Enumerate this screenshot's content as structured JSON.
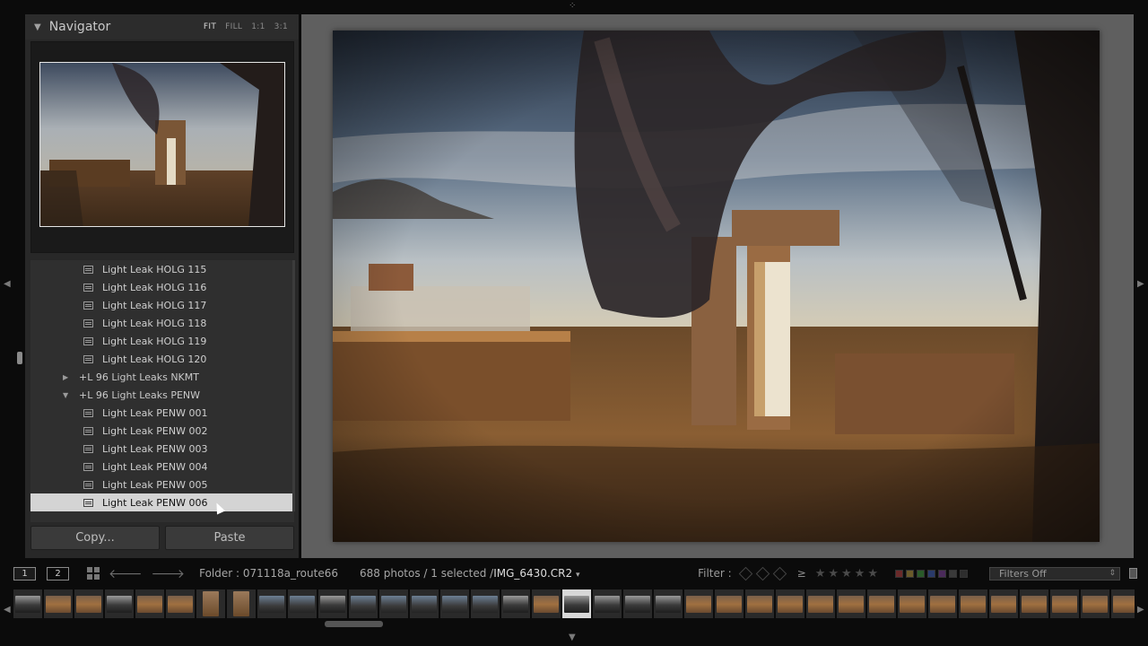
{
  "navigator": {
    "title": "Navigator",
    "zoom_options": [
      "FIT",
      "FILL",
      "1:1",
      "3:1"
    ],
    "active_zoom": "FIT"
  },
  "presets": [
    {
      "type": "preset",
      "label": "Light Leak HOLG 115"
    },
    {
      "type": "preset",
      "label": "Light Leak HOLG 116"
    },
    {
      "type": "preset",
      "label": "Light Leak HOLG 117"
    },
    {
      "type": "preset",
      "label": "Light Leak HOLG 118"
    },
    {
      "type": "preset",
      "label": "Light Leak HOLG 119"
    },
    {
      "type": "preset",
      "label": "Light Leak HOLG 120"
    },
    {
      "type": "folder",
      "label": "+L 96 Light Leaks NKMT",
      "expanded": false
    },
    {
      "type": "folder",
      "label": "+L 96 Light Leaks PENW",
      "expanded": true
    },
    {
      "type": "preset",
      "label": "Light Leak PENW 001"
    },
    {
      "type": "preset",
      "label": "Light Leak PENW 002"
    },
    {
      "type": "preset",
      "label": "Light Leak PENW 003"
    },
    {
      "type": "preset",
      "label": "Light Leak PENW 004"
    },
    {
      "type": "preset",
      "label": "Light Leak PENW 005"
    },
    {
      "type": "preset",
      "label": "Light Leak PENW 006",
      "selected": true
    }
  ],
  "buttons": {
    "copy": "Copy...",
    "paste": "Paste"
  },
  "toolbar": {
    "screen1": "1",
    "screen2": "2",
    "folder": "Folder : 071118a_route66",
    "count": "688 photos / 1 selected /",
    "filename": "IMG_6430.CR2",
    "filter_label": "Filter :",
    "rating_op": "≥",
    "filters_off": "Filters Off"
  },
  "colors": {
    "swatches": [
      "#6a2a2a",
      "#6a5a2a",
      "#2a5a2a",
      "#2a3a6a",
      "#4a2a5a",
      "#3a3a3a",
      "#2e2e2e"
    ]
  },
  "filmstrip": {
    "thumbs": [
      "dark",
      "warm",
      "warm",
      "dark",
      "warm",
      "warm",
      "portrait",
      "portrait",
      "blue",
      "blue",
      "dark",
      "blue",
      "blue",
      "blue",
      "blue",
      "blue",
      "dark",
      "warm",
      "dark",
      "dark",
      "dark",
      "dark",
      "warm",
      "warm",
      "warm",
      "warm",
      "warm",
      "warm",
      "warm",
      "warm",
      "warm",
      "warm",
      "warm",
      "warm",
      "warm",
      "warm",
      "warm"
    ],
    "selected_index": 18
  }
}
